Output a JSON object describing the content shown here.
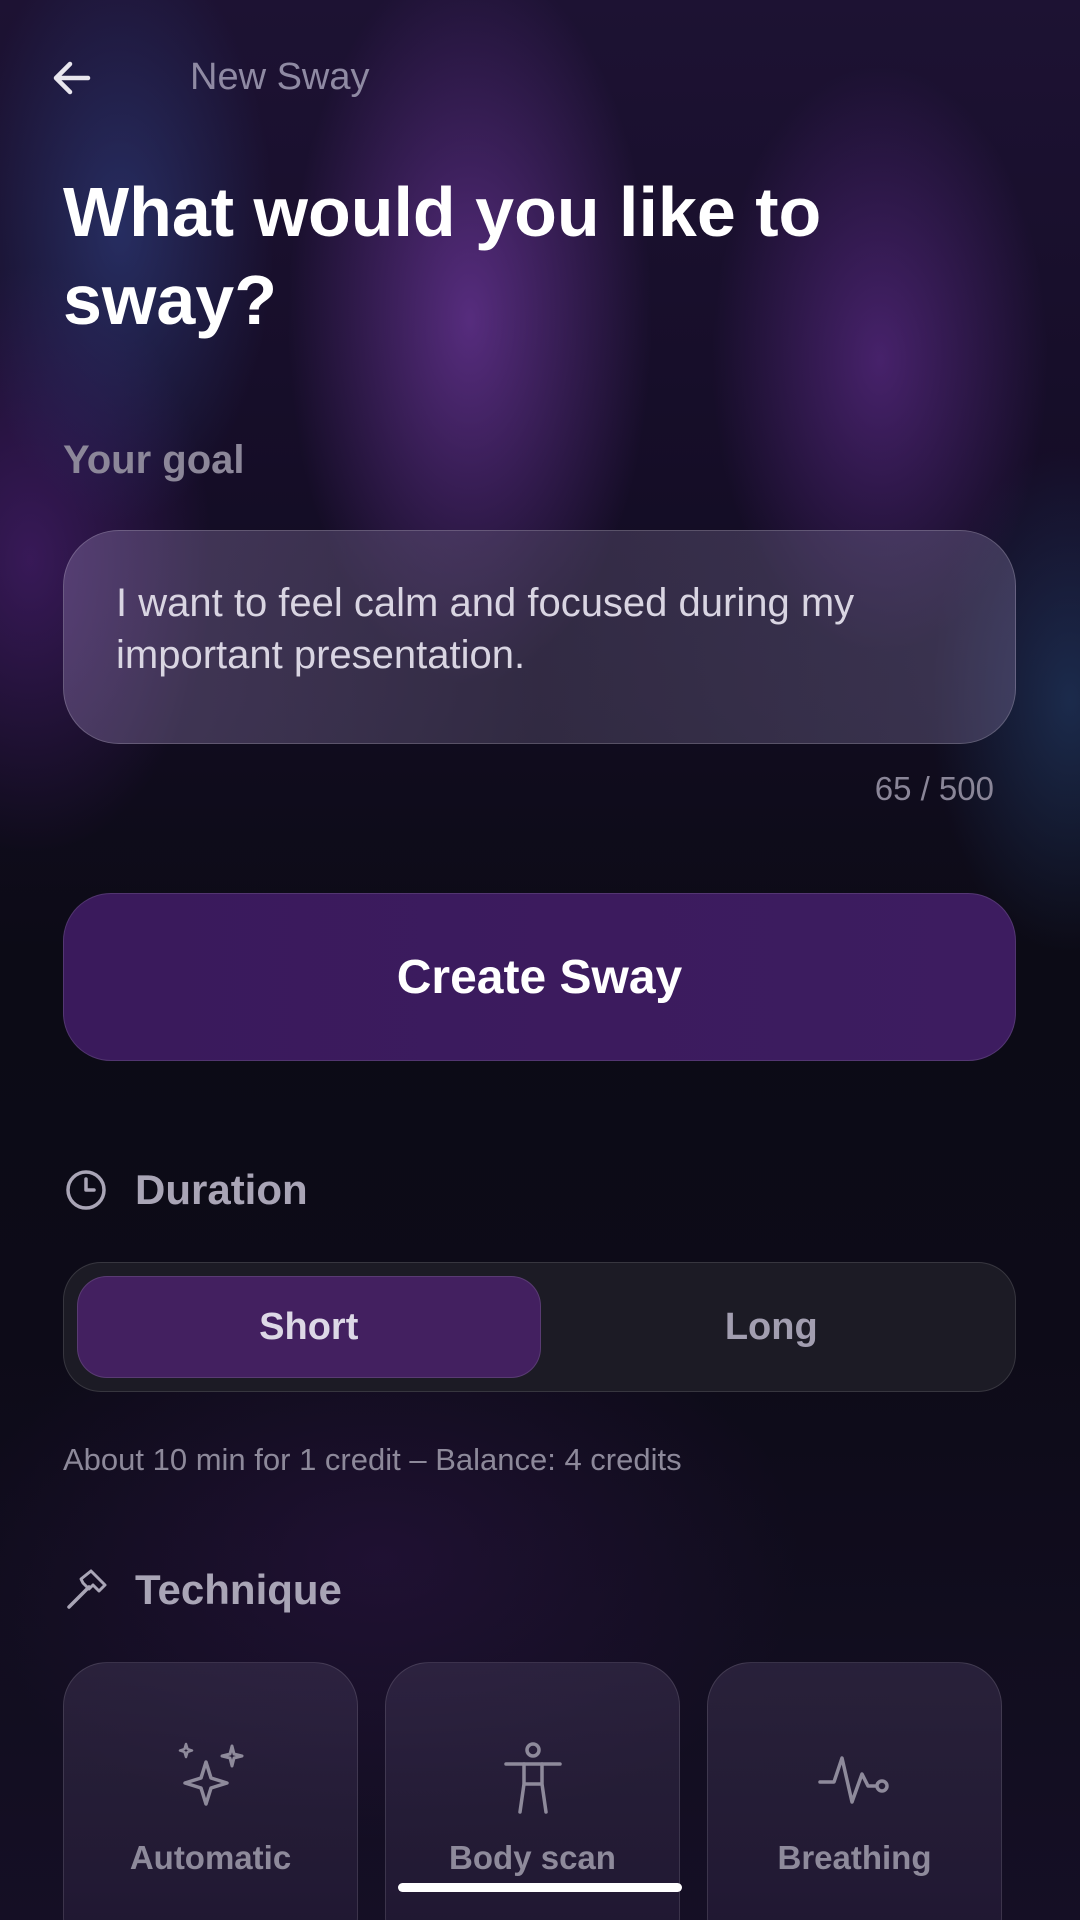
{
  "header": {
    "title": "New Sway"
  },
  "page": {
    "title": "What would you like to sway?"
  },
  "goal": {
    "label": "Your goal",
    "value": "I want to feel calm and focused during my important presentation.",
    "char_count": "65 / 500"
  },
  "create_button": {
    "label": "Create Sway"
  },
  "duration": {
    "title": "Duration",
    "options": [
      {
        "label": "Short",
        "selected": true
      },
      {
        "label": "Long",
        "selected": false
      }
    ],
    "info": "About 10 min for 1 credit – Balance: 4 credits"
  },
  "technique": {
    "title": "Technique",
    "options": [
      {
        "label": "Automatic",
        "icon": "sparkles-icon"
      },
      {
        "label": "Body scan",
        "icon": "person-icon"
      },
      {
        "label": "Breathing",
        "icon": "pulse-icon"
      }
    ]
  },
  "colors": {
    "accent": "#432060",
    "create_button": "#3a1a5c"
  }
}
